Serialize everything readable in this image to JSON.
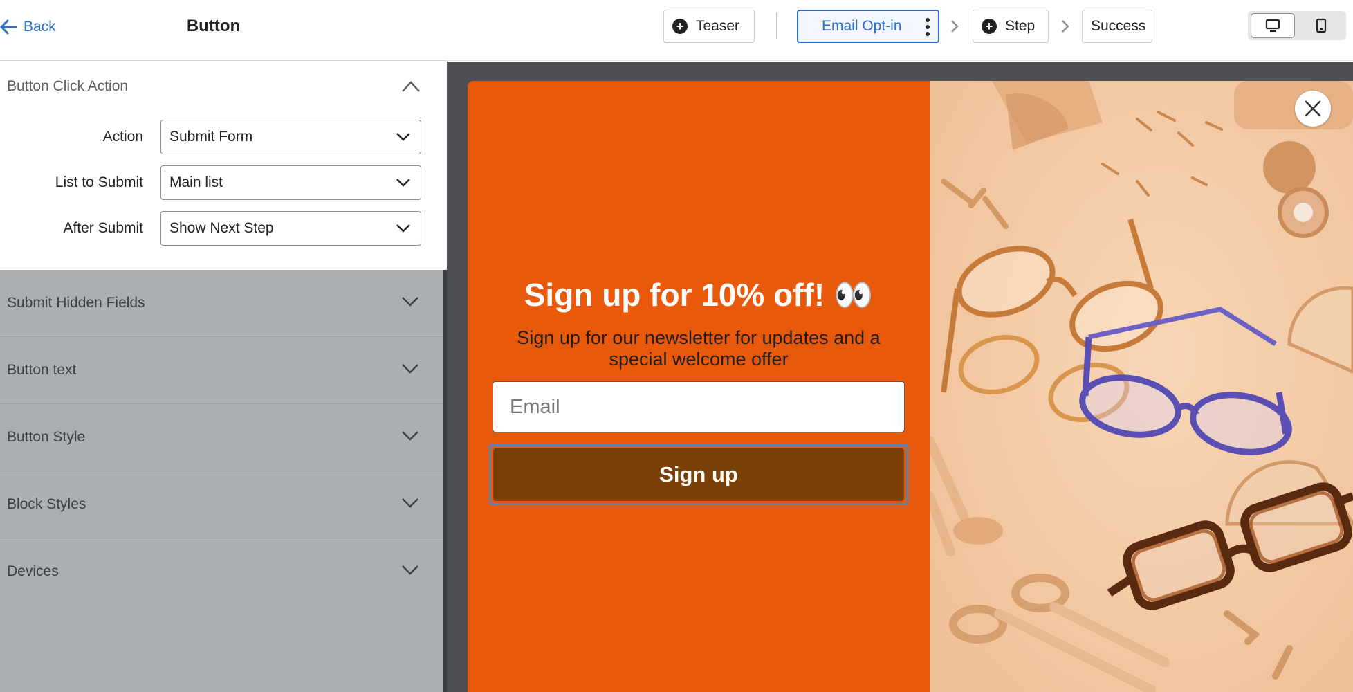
{
  "sidebar": {
    "back_label": "Back",
    "title": "Button",
    "open_section": {
      "title": "Button Click Action",
      "fields": [
        {
          "label": "Action",
          "value": "Submit Form"
        },
        {
          "label": "List to Submit",
          "value": "Main list"
        },
        {
          "label": "After Submit",
          "value": "Show Next Step"
        }
      ]
    },
    "collapsed_sections": [
      "Submit Hidden Fields",
      "Button text",
      "Button Style",
      "Block Styles",
      "Devices"
    ]
  },
  "topbar": {
    "steps": [
      "Teaser",
      "Email Opt-in",
      "Step",
      "Success"
    ],
    "active_step": "Email Opt-in",
    "device_options": [
      "desktop-icon",
      "mobile-icon"
    ],
    "selected_device": "desktop"
  },
  "popup": {
    "headline": "Sign up for 10% off! 👀",
    "subtext": "Sign up for our newsletter for updates and a special welcome offer",
    "email_placeholder": "Email",
    "button_label": "Sign up",
    "colors": {
      "left_panel": "#e8590c",
      "button": "#7a4005",
      "image_bg": "#f5cba6"
    }
  }
}
